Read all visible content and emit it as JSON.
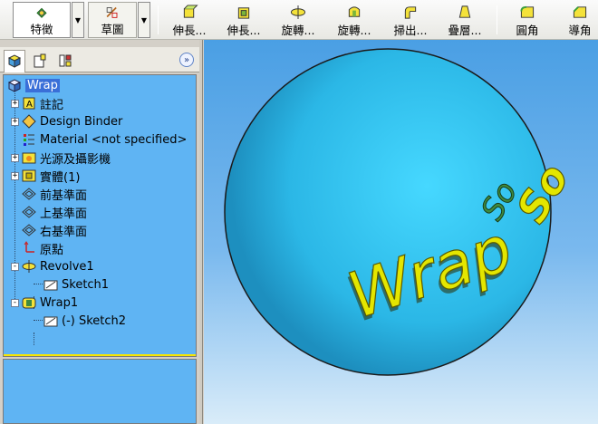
{
  "toolbar": {
    "buttons": [
      {
        "label": "特徵",
        "icon": "feature-icon"
      },
      {
        "label": "草圖",
        "icon": "sketch-icon"
      },
      {
        "label": "伸長...",
        "icon": "extrude-boss-icon"
      },
      {
        "label": "伸長...",
        "icon": "extrude-cut-icon"
      },
      {
        "label": "旋轉...",
        "icon": "revolve-boss-icon"
      },
      {
        "label": "旋轉...",
        "icon": "revolve-cut-icon"
      },
      {
        "label": "掃出...",
        "icon": "sweep-icon"
      },
      {
        "label": "疊層...",
        "icon": "loft-icon"
      },
      {
        "label": "圓角",
        "icon": "fillet-icon"
      },
      {
        "label": "導角",
        "icon": "chamfer-icon"
      }
    ]
  },
  "panel": {
    "tabs": [
      "feature-manager-tab",
      "property-manager-tab",
      "configuration-manager-tab"
    ],
    "collapse": "»"
  },
  "tree": {
    "root": "Wrap",
    "nodes": [
      {
        "label": "註記",
        "expander": "+",
        "icon": "annotations-icon"
      },
      {
        "label": "Design Binder",
        "expander": "+",
        "icon": "design-binder-icon"
      },
      {
        "label": "Material <not specified>",
        "expander": "",
        "icon": "material-icon"
      },
      {
        "label": "光源及攝影機",
        "expander": "+",
        "icon": "lights-cameras-icon"
      },
      {
        "label": "實體(1)",
        "expander": "+",
        "icon": "solid-bodies-icon"
      },
      {
        "label": "前基準面",
        "expander": "",
        "icon": "plane-icon"
      },
      {
        "label": "上基準面",
        "expander": "",
        "icon": "plane-icon"
      },
      {
        "label": "右基準面",
        "expander": "",
        "icon": "plane-icon"
      },
      {
        "label": "原點",
        "expander": "",
        "icon": "origin-icon"
      },
      {
        "label": "Revolve1",
        "expander": "-",
        "icon": "revolve-feature-icon"
      },
      {
        "label": "Sketch1",
        "expander": "",
        "icon": "sketch-feature-icon",
        "child": true
      },
      {
        "label": "Wrap1",
        "expander": "-",
        "icon": "wrap-feature-icon"
      },
      {
        "label": "(-) Sketch2",
        "expander": "",
        "icon": "sketch-feature-icon",
        "child": true
      }
    ]
  },
  "viewport": {
    "model_text": "Wrap",
    "wrapped_text_end": "So",
    "colors": {
      "sphere": "#35c8f2",
      "text": "#e4e600",
      "selected": "#3f8a3f"
    }
  }
}
